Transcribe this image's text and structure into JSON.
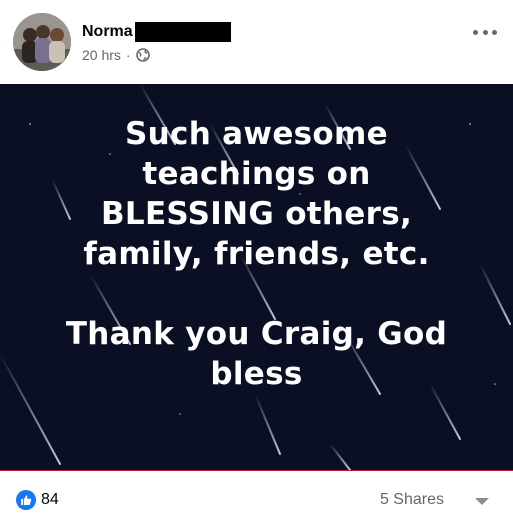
{
  "post": {
    "author": {
      "name_visible": "Norma",
      "name_redacted": true
    },
    "meta": {
      "time": "20 hrs",
      "separator": "·",
      "audience_icon": "globe-icon"
    },
    "more_icon": "more-options-icon",
    "image_text": {
      "paragraph1": [
        "Such awesome",
        "teachings on",
        "BLESSING others,",
        "family, friends, etc."
      ],
      "paragraph2": [
        "Thank you Craig, God",
        "bless"
      ]
    },
    "reactions": {
      "icon": "like-icon",
      "count": "84"
    },
    "shares": "5 Shares",
    "dropdown_icon": "chevron-down-icon"
  },
  "colors": {
    "image_background": "#0a0f24",
    "like_blue": "#1877f2",
    "meta_gray": "#65676b",
    "divider": "#b5223a"
  }
}
